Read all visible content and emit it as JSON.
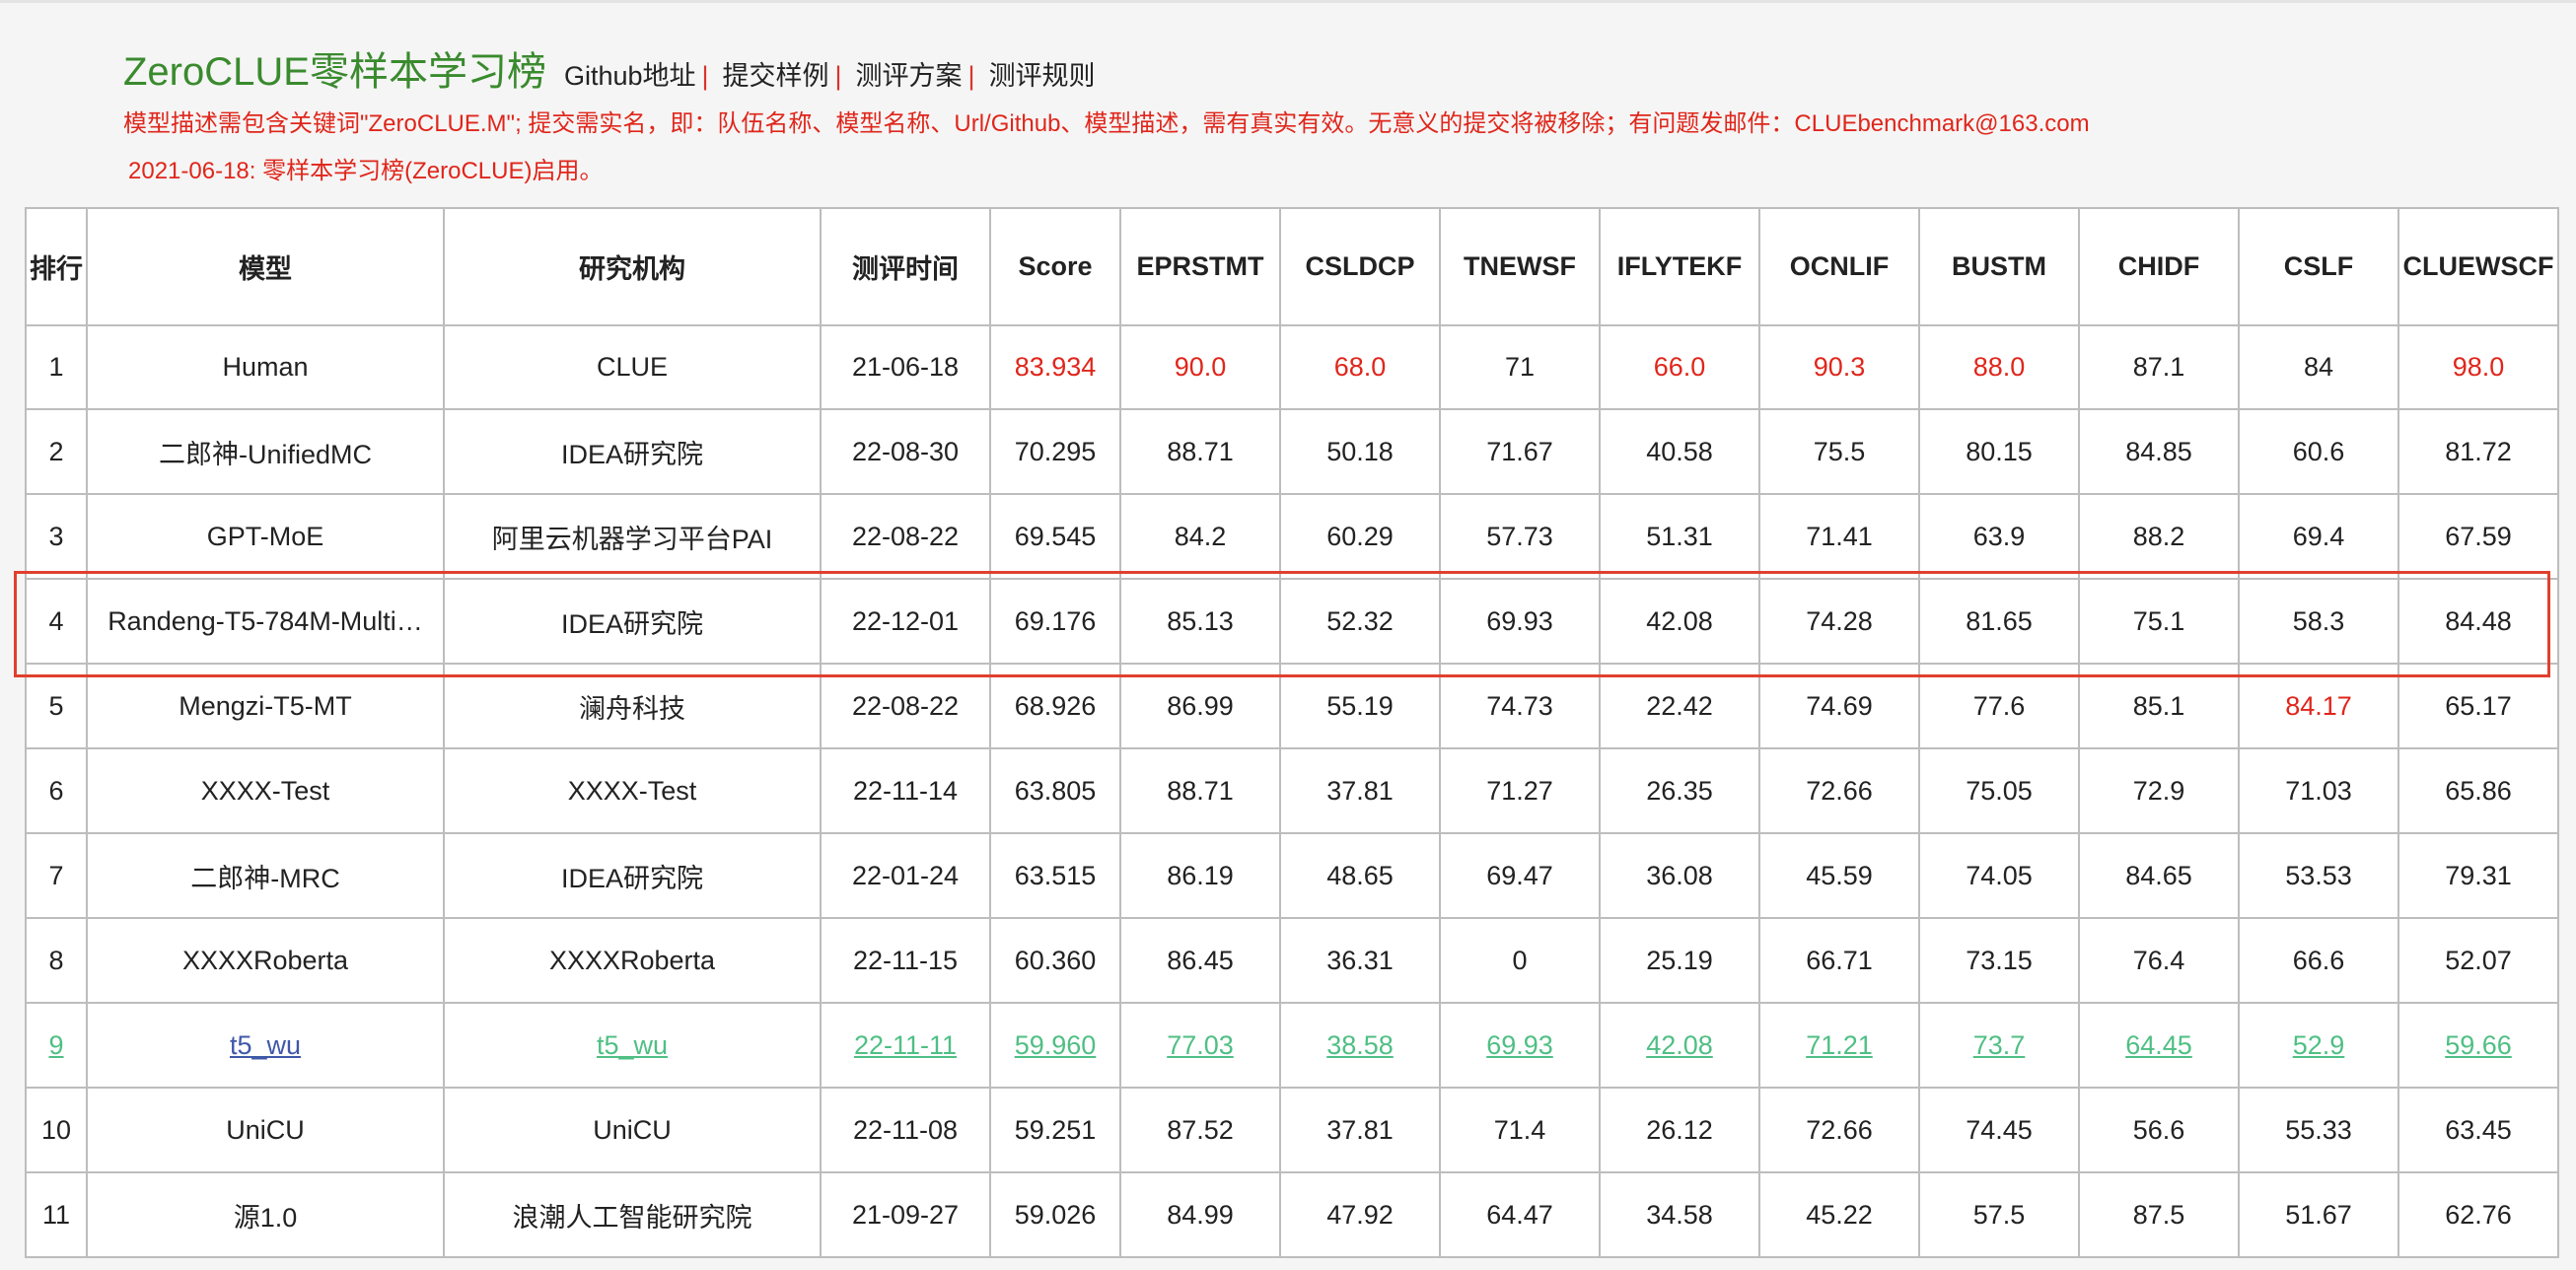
{
  "header": {
    "title": "ZeroCLUE零样本学习榜",
    "nav": [
      "Github地址",
      "提交样例",
      "测评方案",
      "测评规则"
    ],
    "separator": "|"
  },
  "notice": "模型描述需包含关键词\"ZeroCLUE.M\"; 提交需实名，即：队伍名称、模型名称、Url/Github、模型描述，需有真实有效。无意义的提交将被移除；有问题发邮件：CLUEbenchmark@163.com",
  "notice2": "2021-06-18: 零样本学习榜(ZeroCLUE)启用。",
  "colors": {
    "title": "#3a8a2e",
    "notice": "#e0261b",
    "model_link": "#3f58a8",
    "visited_link": "#4fbf84",
    "highlight_border": "#e0402e"
  },
  "table": {
    "headers": [
      "排行",
      "模型",
      "研究机构",
      "测评时间",
      "Score",
      "EPRSTMT",
      "CSLDCP",
      "TNEWSF",
      "IFLYTEKF",
      "OCNLIF",
      "BUSTM",
      "CHIDF",
      "CSLF",
      "CLUEWSCF"
    ],
    "rows": [
      {
        "cells": [
          "1",
          "Human",
          "CLUE",
          "21-06-18",
          "83.934",
          "90.0",
          "68.0",
          "71",
          "66.0",
          "90.3",
          "88.0",
          "87.1",
          "84",
          "98.0"
        ],
        "red": [
          4,
          5,
          6,
          8,
          9,
          10,
          13
        ]
      },
      {
        "cells": [
          "2",
          "二郎神-UnifiedMC",
          "IDEA研究院",
          "22-08-30",
          "70.295",
          "88.71",
          "50.18",
          "71.67",
          "40.58",
          "75.5",
          "80.15",
          "84.85",
          "60.6",
          "81.72"
        ],
        "red": []
      },
      {
        "cells": [
          "3",
          "GPT-MoE",
          "阿里云机器学习平台PAI",
          "22-08-22",
          "69.545",
          "84.2",
          "60.29",
          "57.73",
          "51.31",
          "71.41",
          "63.9",
          "88.2",
          "69.4",
          "67.59"
        ],
        "red": []
      },
      {
        "cells": [
          "4",
          "Randeng-T5-784M-Multi…",
          "IDEA研究院",
          "22-12-01",
          "69.176",
          "85.13",
          "52.32",
          "69.93",
          "42.08",
          "74.28",
          "81.65",
          "75.1",
          "58.3",
          "84.48"
        ],
        "red": [],
        "highlighted": true
      },
      {
        "cells": [
          "5",
          "Mengzi-T5-MT",
          "澜舟科技",
          "22-08-22",
          "68.926",
          "86.99",
          "55.19",
          "74.73",
          "22.42",
          "74.69",
          "77.6",
          "85.1",
          "84.17",
          "65.17"
        ],
        "red": [
          12
        ]
      },
      {
        "cells": [
          "6",
          "XXXX-Test",
          "XXXX-Test",
          "22-11-14",
          "63.805",
          "88.71",
          "37.81",
          "71.27",
          "26.35",
          "72.66",
          "75.05",
          "72.9",
          "71.03",
          "65.86"
        ],
        "red": []
      },
      {
        "cells": [
          "7",
          "二郎神-MRC",
          "IDEA研究院",
          "22-01-24",
          "63.515",
          "86.19",
          "48.65",
          "69.47",
          "36.08",
          "45.59",
          "74.05",
          "84.65",
          "53.53",
          "79.31"
        ],
        "red": []
      },
      {
        "cells": [
          "8",
          "XXXXRoberta",
          "XXXXRoberta",
          "22-11-15",
          "60.360",
          "86.45",
          "36.31",
          "0",
          "25.19",
          "66.71",
          "73.15",
          "76.4",
          "66.6",
          "52.07"
        ],
        "red": []
      },
      {
        "cells": [
          "9",
          "t5_wu",
          "t5_wu",
          "22-11-11",
          "59.960",
          "77.03",
          "38.58",
          "69.93",
          "42.08",
          "71.21",
          "73.7",
          "64.45",
          "52.9",
          "59.66"
        ],
        "red": [],
        "linked": true
      },
      {
        "cells": [
          "10",
          "UniCU",
          "UniCU",
          "22-11-08",
          "59.251",
          "87.52",
          "37.81",
          "71.4",
          "26.12",
          "72.66",
          "74.45",
          "56.6",
          "55.33",
          "63.45"
        ],
        "red": []
      },
      {
        "cells": [
          "11",
          "源1.0",
          "浪潮人工智能研究院",
          "21-09-27",
          "59.026",
          "84.99",
          "47.92",
          "64.47",
          "34.58",
          "45.22",
          "57.5",
          "87.5",
          "51.67",
          "62.76"
        ],
        "red": []
      }
    ]
  }
}
